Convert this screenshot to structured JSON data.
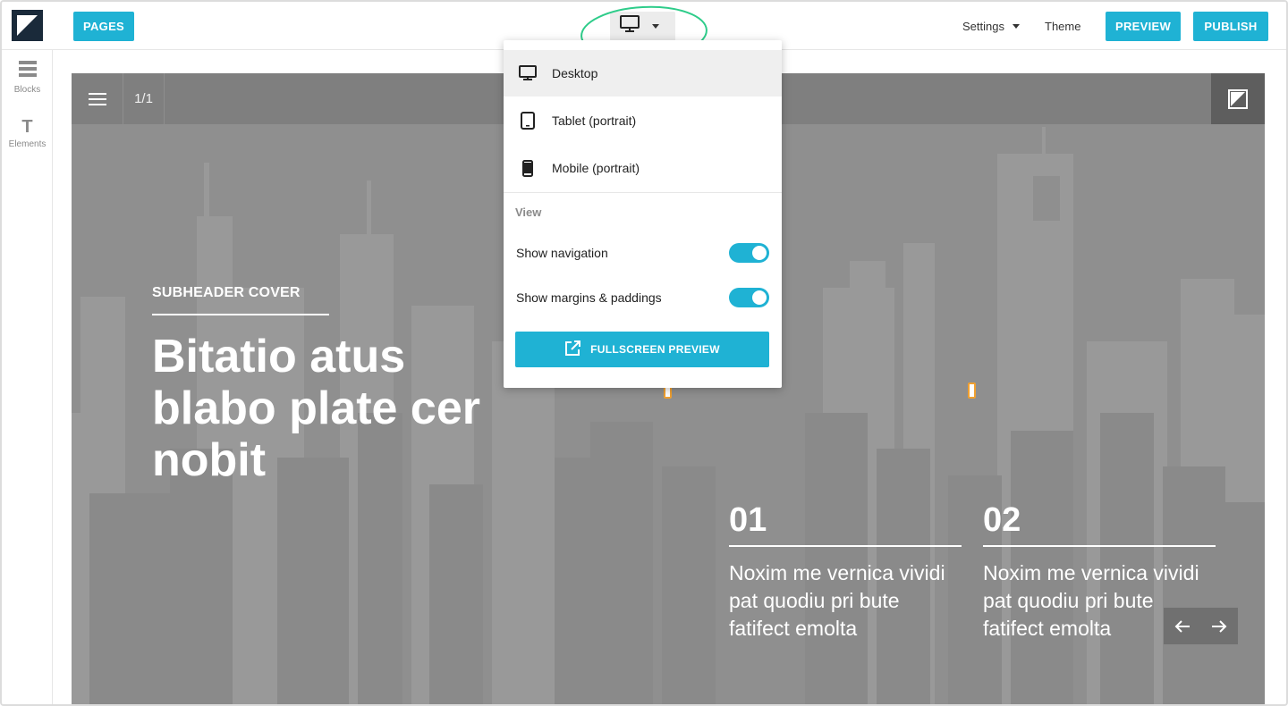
{
  "toolbar": {
    "pages_label": "PAGES",
    "settings_label": "Settings",
    "theme_label": "Theme",
    "preview_label": "PREVIEW",
    "publish_label": "PUBLISH",
    "device_icon": "desktop-icon"
  },
  "sidebar": {
    "items": [
      {
        "label": "Blocks",
        "icon": "blocks-icon"
      },
      {
        "label": "Elements",
        "icon": "text-icon"
      }
    ]
  },
  "canvas": {
    "page_count": "1/1",
    "subheader": "SUBHEADER COVER",
    "headline": "Bitatio atus blabo plate cer nobit",
    "features": [
      {
        "number": "01",
        "text": "Noxim me vernica vividi pat quodiu pri bute fatifect emolta"
      },
      {
        "number": "02",
        "text": "Noxim me vernica vividi pat quodiu pri bute fatifect emolta"
      }
    ]
  },
  "device_menu": {
    "devices": [
      {
        "label": "Desktop",
        "icon": "desktop-icon",
        "selected": true
      },
      {
        "label": "Tablet (portrait)",
        "icon": "tablet-icon",
        "selected": false
      },
      {
        "label": "Mobile (portrait)",
        "icon": "mobile-icon",
        "selected": false
      }
    ],
    "view_heading": "View",
    "toggles": [
      {
        "label": "Show navigation",
        "on": true
      },
      {
        "label": "Show margins & paddings",
        "on": true
      }
    ],
    "fullscreen_label": "FULLSCREEN PREVIEW"
  },
  "colors": {
    "accent": "#1fb2d4",
    "annotation": "#2ecc8a",
    "canvas_bg": "#8f8f8f"
  }
}
